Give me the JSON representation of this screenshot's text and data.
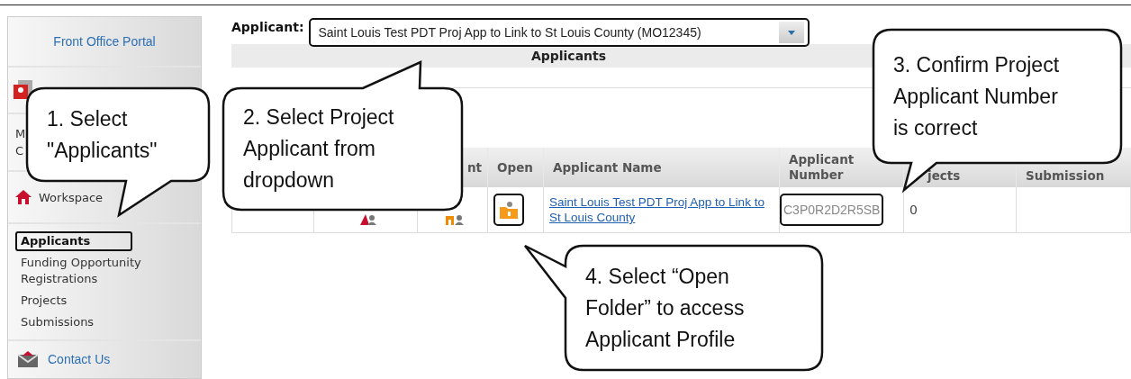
{
  "sidebar": {
    "title": "Front Office Portal",
    "covered_lines": [
      "M",
      "C"
    ],
    "workspace": "Workspace",
    "links": [
      {
        "label": "Applicants",
        "selected": true
      },
      {
        "label": "Funding Opportunity Registrations",
        "selected": false
      },
      {
        "label": "Projects",
        "selected": false
      },
      {
        "label": "Submissions",
        "selected": false
      }
    ],
    "contact": "Contact Us"
  },
  "applicant_select": {
    "label": "Applicant:",
    "value": "Saint Louis Test PDT Proj App to Link to St Louis County (MO12345)"
  },
  "section_title": "Applicants",
  "table": {
    "columns": [
      "",
      "",
      "nt",
      "Open",
      "Applicant Name",
      "Applicant Number",
      "jects",
      "Submission"
    ],
    "rows": [
      {
        "name": "Saint Louis Test PDT Proj App to Link to St Louis County",
        "number": "C3P0R2D2R5SB",
        "projects": "0"
      }
    ]
  },
  "callouts": [
    {
      "text": "1. Select\n\"Applicants\""
    },
    {
      "text": "2. Select Project\nApplicant from\ndropdown"
    },
    {
      "text": "3. Confirm Project\nApplicant Number\nis correct"
    },
    {
      "text": "4. Select “Open\nFolder” to access\nApplicant Profile"
    }
  ]
}
